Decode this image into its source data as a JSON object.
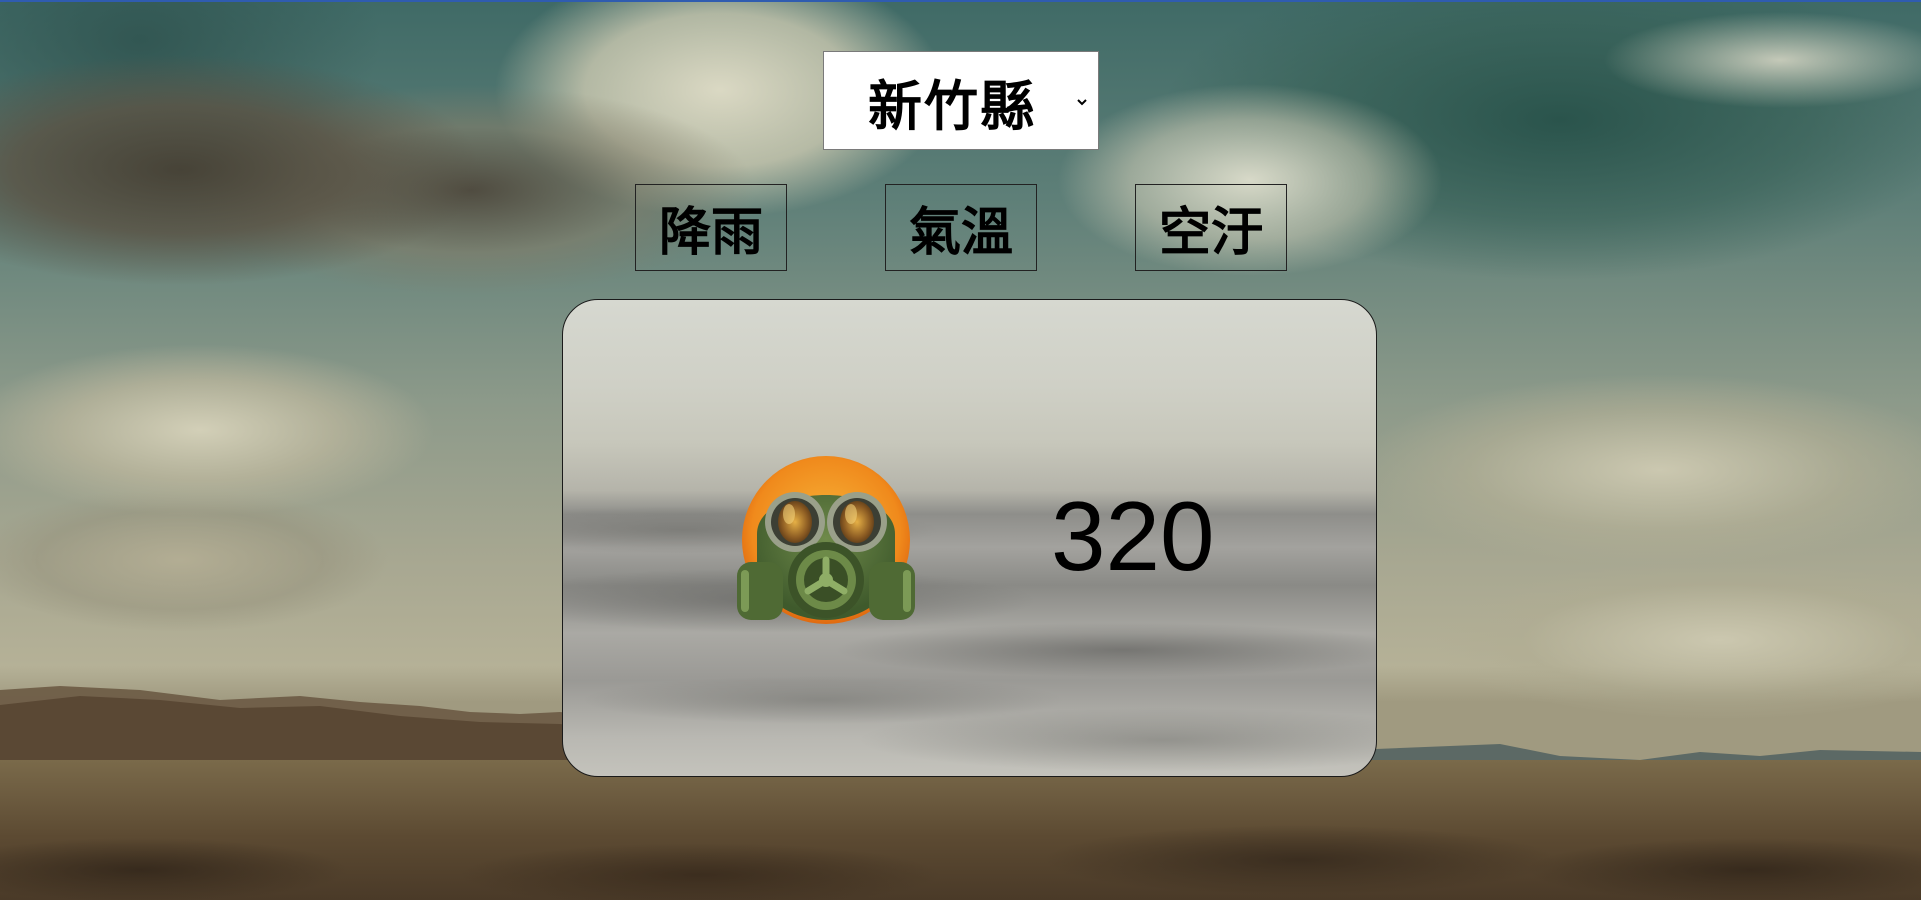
{
  "location": {
    "selected_city": "新竹縣"
  },
  "tabs": [
    {
      "label": "降雨"
    },
    {
      "label": "氣溫"
    },
    {
      "label": "空汙"
    }
  ],
  "result": {
    "value": "320",
    "status_icon": "gas-mask-icon"
  },
  "colors": {
    "top_accent": "#2f5cb0",
    "select_bg": "#ffffff",
    "text": "#000000"
  }
}
